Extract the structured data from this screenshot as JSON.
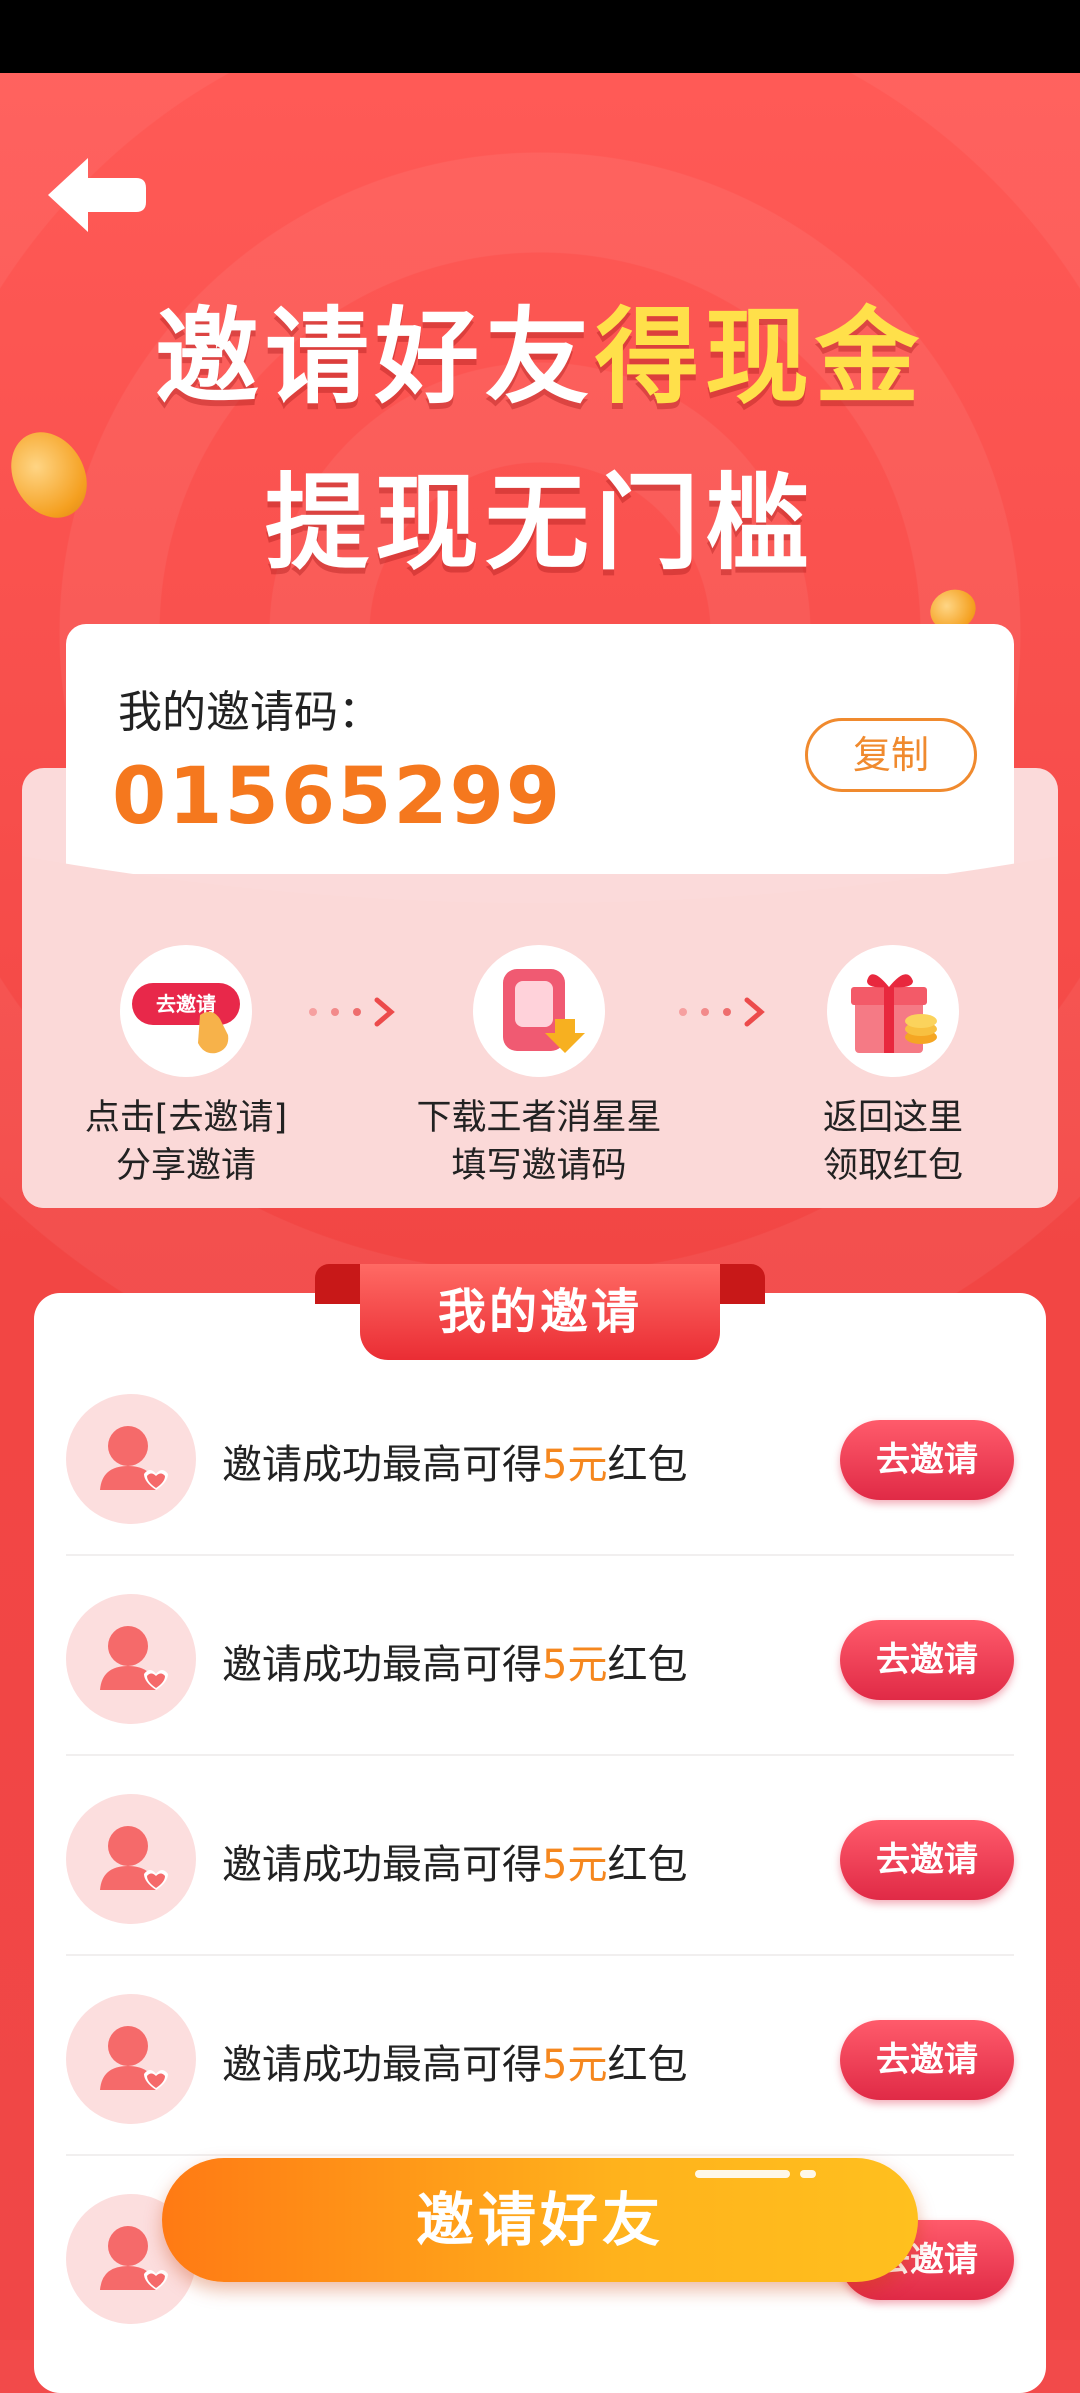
{
  "header": {
    "title_part1": "邀请好友",
    "title_part2": "得现金",
    "subtitle": "提现无门槛"
  },
  "code_card": {
    "label": "我的邀请码：",
    "code": "01565299",
    "copy_label": "复制"
  },
  "steps": [
    {
      "badge": "去邀请",
      "line1": "点击[去邀请]",
      "line2": "分享邀请"
    },
    {
      "line1": "下载王者消星星",
      "line2": "填写邀请码"
    },
    {
      "line1": "返回这里",
      "line2": "领取红包"
    }
  ],
  "invites": {
    "title": "我的邀请",
    "rows": [
      {
        "prefix": "邀请成功最高可得",
        "amount": "5元",
        "suffix": "红包",
        "button": "去邀请"
      },
      {
        "prefix": "邀请成功最高可得",
        "amount": "5元",
        "suffix": "红包",
        "button": "去邀请"
      },
      {
        "prefix": "邀请成功最高可得",
        "amount": "5元",
        "suffix": "红包",
        "button": "去邀请"
      },
      {
        "prefix": "邀请成功最高可得",
        "amount": "5元",
        "suffix": "红包",
        "button": "去邀请"
      },
      {
        "prefix": "",
        "amount": "",
        "suffix": "",
        "button": "去邀请"
      }
    ]
  },
  "cta": {
    "label": "邀请好友"
  },
  "colors": {
    "background": "#f24a4a",
    "accent_orange": "#f5781e",
    "title_gold": "#ffe04a",
    "button_red": "#e02a46"
  }
}
